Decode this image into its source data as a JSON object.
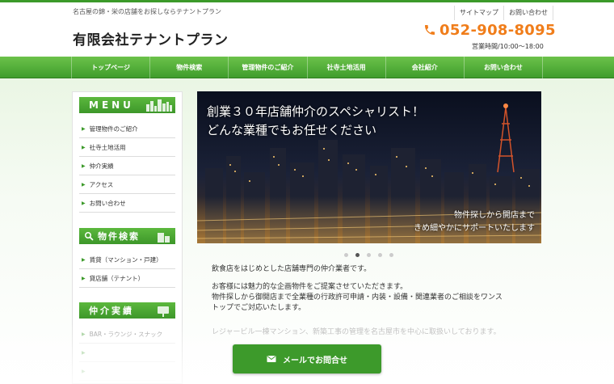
{
  "header": {
    "tagline": "名古屋の錦・栄の店舗をお探しならテナントプラン",
    "company_name": "有限会社テナントプラン",
    "links": [
      "サイトマップ",
      "お問い合わせ"
    ],
    "phone": "052-908-8095",
    "hours": "営業時間/10:00～18:00"
  },
  "nav": {
    "items": [
      "トップページ",
      "物件検索",
      "管理物件のご紹介",
      "社寺土地活用",
      "会社紹介",
      "お問い合わせ"
    ]
  },
  "sidebar": {
    "menu_title": "MENU",
    "menu_items": [
      "管理物件のご紹介",
      "社寺土地活用",
      "仲介実績",
      "アクセス",
      "お問い合わせ"
    ],
    "search_title": "物件検索",
    "search_items": [
      "賃貸（マンション・戸建）",
      "貸店舗（テナント）"
    ],
    "results_title": "仲介実績",
    "results_items": [
      "BAR・ラウンジ・スナック",
      "",
      ""
    ]
  },
  "slider": {
    "title_lines": [
      "創業３０年店舗仲介のスペシャリスト！",
      "どんな業種でもお任せください"
    ],
    "sub_lines": [
      "物件探しから開店まで",
      "きめ細やかにサポートいたします"
    ],
    "dot_count": 5,
    "active_dot": 1
  },
  "main": {
    "p1": "飲食店をはじめとした店舗専門の仲介業者です。",
    "p2_line1": "お客様には魅力的な企画物件をご提案させていただきます。",
    "p2_line2": "物件探しから御開店まで全業種の行政許可申請・内装・設備・関連業者のご相談をワンス",
    "p2_line3": "トップでご対応いたします。",
    "faded_line": "レジャービル一棟マンション、新築工事の管理を名古屋市を中心に取扱いしております。"
  },
  "cta": {
    "label": "メールでお問合せ"
  },
  "colors": {
    "accent_green": "#3d9a2b",
    "phone_orange": "#f07d1a"
  }
}
